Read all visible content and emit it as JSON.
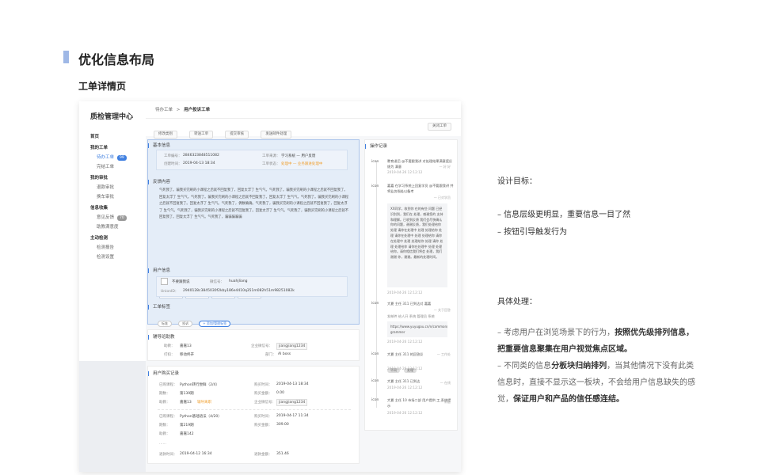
{
  "header": {
    "title": "优化信息布局",
    "subtitle": "工单详情页"
  },
  "app": {
    "brand": "质检管理中心",
    "menu": [
      {
        "label": "首页",
        "type": "group"
      },
      {
        "label": "我的工单",
        "type": "group"
      },
      {
        "label": "待办工单",
        "type": "item",
        "active": true,
        "badge": "99"
      },
      {
        "label": "完结工单",
        "type": "item"
      },
      {
        "label": "我的审批",
        "type": "group"
      },
      {
        "label": "退款审批",
        "type": "item"
      },
      {
        "label": "换车审批",
        "type": "item"
      },
      {
        "label": "信息收集",
        "type": "group"
      },
      {
        "label": "意见反馈",
        "type": "item",
        "badge": "70"
      },
      {
        "label": "助教满意度",
        "type": "item"
      },
      {
        "label": "主动检测",
        "type": "group"
      },
      {
        "label": "检测报告",
        "type": "item"
      },
      {
        "label": "检测设置",
        "type": "item"
      }
    ],
    "breadcrumb": {
      "parent": "待办工单",
      "sep": ">",
      "current": "用户投诉工单"
    },
    "toolbar": [
      "修改类别",
      "转送工单",
      "提交审核",
      "发送邮件处理"
    ],
    "toolbar_right": "关闭工单",
    "basic": {
      "title": "基本信息",
      "order_no_label": "工单编号：",
      "order_no": "2846323848511082",
      "source_label": "工单来源：",
      "source": "学习系统 — 用户反馈",
      "created_label": "创建时间：",
      "created": "2019-04-13 18:34",
      "status_label": "工单状态：",
      "status": "处理中 — 业务跟进处理中"
    },
    "feedback": {
      "title": "反馈内容",
      "text": "气死我了。骗我买完刷的小课程之后就不回复我了，回复太浮了 生气气。气死我了。骗我买完刷的小课程之后就不回复我了。回复太浮了 生气气。气死我了。骗我买完刷的小课程之后就不回复我了。回复太浮了 生气气。气死我了。骗我买完刷的小课程之后就不回复我了。回复太浮了 生气气。气死我了，偶数确确。气死我了，骗我买完刷的小课程之后就不回复我了，回复太浮了 生气气。气死我了，骗我买完刷的小课程之后就不回复我了。回复太浮了 生气气。气死我了，骗我买完刷的小课程之后就不回复我了。回复太浮了 生气气。气死我了，骗骗骗骗骗"
    },
    "user": {
      "title": "用户信息",
      "nickname": "不要跟我说",
      "nickname_label": "微信号：",
      "wechat": "huahjliang",
      "union_label": "UnionID：",
      "union_id": "2940128c3845030f2kby186e4410q351m082h51m98251082k"
    },
    "tags": {
      "title": "工单标签",
      "items": [
        "标准",
        "投诉"
      ],
      "add": "+ 添加/管理标签"
    },
    "assistant": {
      "title": "辅导班助教",
      "teacher_label": "助教：",
      "teacher": "嘉嘉13",
      "wechat_label": "企业微信号：",
      "wechat": "jiangjiang1234",
      "phone_label": "打扣：",
      "phone": "移动终开",
      "dept_label": "部门：",
      "dept": "AI boss"
    },
    "purchase": {
      "title": "用户购买记录",
      "r1_course_label": "已购课程：",
      "r1_course": "Python转行尝鲜（2/4）",
      "r1_time_label": "购买时间：",
      "r1_time": "2019-04-13 18:34",
      "r1_term_label": "期数：",
      "r1_term": "第139期",
      "r1_amount_label": "购买金额：",
      "r1_amount": "0.00",
      "r1_teacher_label": "助教：",
      "r1_teacher": "嘉嘉13",
      "r1_tag": "辅导离职",
      "r1_wechat_label": "企业微信号：",
      "r1_wechat": "jiangjiang1234",
      "r2_course_label": "已购课程：",
      "r2_course": "Python基础语法（4/20）",
      "r2_time_label": "购买时间：",
      "r2_time": "2019-04-17 11:34",
      "r2_term_label": "期数：",
      "r2_term": "第219期",
      "r2_amount_label": "购买金额：",
      "r2_amount": "309.00",
      "r2_teacher_label": "助教：",
      "r2_teacher": "嘉嘉142",
      "more": "……",
      "r3_time_label": "退款时间：",
      "r3_time": "2019-04-12 16:34",
      "r3_amount_label": "退款金额：",
      "r3_amount": "351.46"
    },
    "ops": {
      "title": "操作记录",
      "e1": {
        "icon": "icon",
        "text": "教育退后 @不要跟我讲 对处理结果满意度反馈为 满意",
        "time": "2019-04-26 12:12:12",
        "right": "一 好 好"
      },
      "e2": {
        "icon": "icon",
        "text": "嘉嘉 在学习系统上回复学员 @不要跟我讲 并将业务指处以备考",
        "right": "一 已对学员",
        "note": "XX同学，收到你 在的有些 问题 已经识别到，我们在 处理，感谢您的 支持和理解。已收到反馈 我们会尽快确认你的问题，谢谢反馈，我们处理给你 处理 请你在处理中 处理 处理给你 处理 请你在处理中 处理 处理给你 请你在处理中 处理 处理给你 处理 请你 处理 处理给你 请你在处理中 处理 处理给你。请你相信我们将会 处理，我们 谢谢 你，谢谢。最新的处理时间。",
        "time": "2019-04-26 12:12:12"
      },
      "e3": {
        "icon": "icon",
        "text": "大夏 主任 311 已到达对 嘉嘉",
        "right": "一 关于回答",
        "sub": "发邮件 给人开 系统 管理员 系统",
        "link": "https://www.yuyugou.cn/n/common/1/box-grammer",
        "time": "2019-04-26 12:12:12"
      },
      "e4": {
        "icon": "icon",
        "text": "大夏 主任 311 的回答反",
        "right": "一 工作处",
        "pills": [
          "不同",
          "处理"
        ],
        "time": "2019-04-26 12:12:12"
      },
      "e5": {
        "icon": "icon",
        "text": "大夏 主任 311 已到达",
        "right": "一 在线",
        "time": "2019-04-26 12:12:12"
      },
      "e6": {
        "icon": "icon",
        "text": "大夏 主任 10 市场二部 用户提供 工 系统提示",
        "right": "一 新题",
        "time": "2019-04-26 12:12:12"
      }
    }
  },
  "design": {
    "goal_title": "设计目标：",
    "goals": [
      "– 信息层级更明显，重要信息一目了然",
      "– 按钮引导触发行为"
    ],
    "method_title": "具体处理：",
    "p1_a": "– 考虑用户在浏览场景下的行为，",
    "p1_b": "按照优先级排列信息，把重要信息聚集在用户视觉焦点区域。",
    "p2_a": "– 不同类的信息",
    "p2_b": "分板块归纳排列",
    "p2_c": "，当其他情况下没有此类信息时，直接不显示这一板块，不会给用户信息缺失的感觉，",
    "p2_d": "保证用户和产品的信任感连结。"
  }
}
